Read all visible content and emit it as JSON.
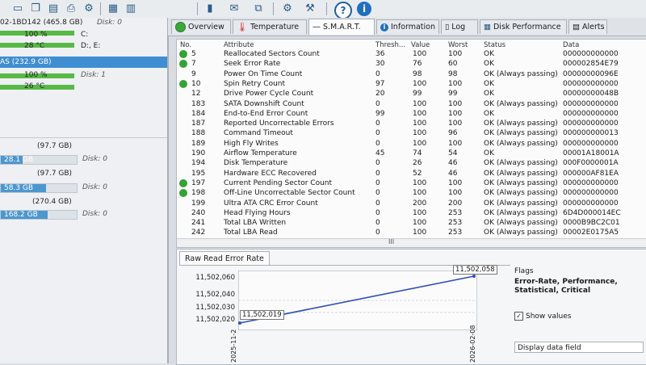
{
  "left_panel": {
    "disk1_title": "02-1BD142 (465.8 GB)",
    "disk1_label": "Disk: 0",
    "disk1_health": "100 %",
    "disk1_health_drive": "C:",
    "disk1_temp": "28 °C",
    "disk1_temp_drive": "D:, E:",
    "disk2_title": "AS (232.9 GB)",
    "disk2_health": "100 %",
    "disk2_label": "Disk: 1",
    "disk2_temp": "26 °C",
    "volumes": [
      {
        "size": "(97.7 GB)",
        "used": "28.1 GB",
        "disk": "Disk: 0",
        "fill": 0.29
      },
      {
        "size": "(97.7 GB)",
        "used": "58.3 GB",
        "disk": "Disk: 0",
        "fill": 0.6
      },
      {
        "size": "(270.4 GB)",
        "used": "168.2 GB",
        "disk": "Disk: 0",
        "fill": 0.62
      }
    ]
  },
  "tabs": [
    "Overview",
    "Temperature",
    "S.M.A.R.T.",
    "Information",
    "Log",
    "Disk Performance",
    "Alerts"
  ],
  "smart": {
    "headers": {
      "no": "No.",
      "attribute": "Attribute",
      "thresh": "Thresh...",
      "value": "Value",
      "worst": "Worst",
      "status": "Status",
      "data": "Data"
    },
    "rows": [
      {
        "no": "5",
        "attr": "Reallocated Sectors Count",
        "thresh": "36",
        "value": "100",
        "worst": "100",
        "status": "OK",
        "data": "000000000000",
        "icon": true
      },
      {
        "no": "7",
        "attr": "Seek Error Rate",
        "thresh": "30",
        "value": "76",
        "worst": "60",
        "status": "OK",
        "data": "000002854E79",
        "icon": true
      },
      {
        "no": "9",
        "attr": "Power On Time Count",
        "thresh": "0",
        "value": "98",
        "worst": "98",
        "status": "OK (Always passing)",
        "data": "00000000096E",
        "icon": false
      },
      {
        "no": "10",
        "attr": "Spin Retry Count",
        "thresh": "97",
        "value": "100",
        "worst": "100",
        "status": "OK",
        "data": "000000000000",
        "icon": true
      },
      {
        "no": "12",
        "attr": "Drive Power Cycle Count",
        "thresh": "20",
        "value": "99",
        "worst": "99",
        "status": "OK",
        "data": "00000000048B",
        "icon": false
      },
      {
        "no": "183",
        "attr": "SATA Downshift Count",
        "thresh": "0",
        "value": "100",
        "worst": "100",
        "status": "OK (Always passing)",
        "data": "000000000000",
        "icon": false
      },
      {
        "no": "184",
        "attr": "End-to-End Error Count",
        "thresh": "99",
        "value": "100",
        "worst": "100",
        "status": "OK",
        "data": "000000000000",
        "icon": false
      },
      {
        "no": "187",
        "attr": "Reported Uncorrectable Errors",
        "thresh": "0",
        "value": "100",
        "worst": "100",
        "status": "OK (Always passing)",
        "data": "000000000000",
        "icon": false
      },
      {
        "no": "188",
        "attr": "Command Timeout",
        "thresh": "0",
        "value": "100",
        "worst": "96",
        "status": "OK (Always passing)",
        "data": "000000000013",
        "icon": false
      },
      {
        "no": "189",
        "attr": "High Fly Writes",
        "thresh": "0",
        "value": "100",
        "worst": "100",
        "status": "OK (Always passing)",
        "data": "000000000000",
        "icon": false
      },
      {
        "no": "190",
        "attr": "Airflow Temperature",
        "thresh": "45",
        "value": "74",
        "worst": "54",
        "status": "OK",
        "data": "00001A18001A",
        "icon": false
      },
      {
        "no": "194",
        "attr": "Disk Temperature",
        "thresh": "0",
        "value": "26",
        "worst": "46",
        "status": "OK (Always passing)",
        "data": "000F0000001A",
        "icon": false
      },
      {
        "no": "195",
        "attr": "Hardware ECC Recovered",
        "thresh": "0",
        "value": "52",
        "worst": "46",
        "status": "OK (Always passing)",
        "data": "000000AF81EA",
        "icon": false
      },
      {
        "no": "197",
        "attr": "Current Pending Sector Count",
        "thresh": "0",
        "value": "100",
        "worst": "100",
        "status": "OK (Always passing)",
        "data": "000000000000",
        "icon": true
      },
      {
        "no": "198",
        "attr": "Off-Line Uncorrectable Sector Count",
        "thresh": "0",
        "value": "100",
        "worst": "100",
        "status": "OK (Always passing)",
        "data": "000000000000",
        "icon": true
      },
      {
        "no": "199",
        "attr": "Ultra ATA CRC Error Count",
        "thresh": "0",
        "value": "200",
        "worst": "200",
        "status": "OK (Always passing)",
        "data": "000000000000",
        "icon": false
      },
      {
        "no": "240",
        "attr": "Head Flying Hours",
        "thresh": "0",
        "value": "100",
        "worst": "253",
        "status": "OK (Always passing)",
        "data": "6D4D000014EC",
        "icon": false
      },
      {
        "no": "241",
        "attr": "Total LBA Written",
        "thresh": "0",
        "value": "100",
        "worst": "253",
        "status": "OK (Always passing)",
        "data": "0000B9BC2C01",
        "icon": false
      },
      {
        "no": "242",
        "attr": "Total LBA Read",
        "thresh": "0",
        "value": "100",
        "worst": "253",
        "status": "OK (Always passing)",
        "data": "00002E0175A5",
        "icon": false
      }
    ],
    "scroll_grip": "III",
    "scroll_left": "◂"
  },
  "chart": {
    "tab_label": "Raw Read Error Rate",
    "point_labels": [
      "11,502,019",
      "11,502,058"
    ],
    "yticks": [
      "11,502,060",
      "11,502,040",
      "11,502,030",
      "11,502,020"
    ],
    "xticks": [
      "2025-11-2",
      "2026-02-08"
    ],
    "line_color": "#2f4fb5"
  },
  "flags": {
    "title": "Flags",
    "text": "Error-Rate, Performance, Statistical, Critical",
    "show_values": "Show values",
    "display_field": "Display data field"
  }
}
